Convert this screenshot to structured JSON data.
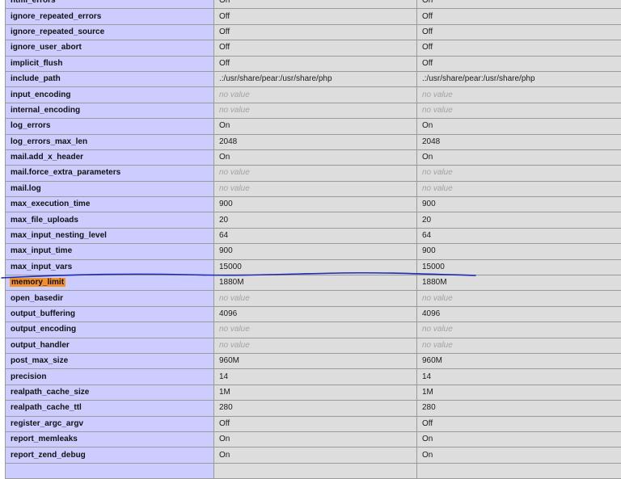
{
  "highlight_color": "#f2902c",
  "annotation_color": "#1e2bb0",
  "table": {
    "no_value_color": "#a3a3a3",
    "rows": [
      {
        "directive": "html_errors",
        "local": "On",
        "master": "On"
      },
      {
        "directive": "ignore_repeated_errors",
        "local": "Off",
        "master": "Off"
      },
      {
        "directive": "ignore_repeated_source",
        "local": "Off",
        "master": "Off"
      },
      {
        "directive": "ignore_user_abort",
        "local": "Off",
        "master": "Off"
      },
      {
        "directive": "implicit_flush",
        "local": "Off",
        "master": "Off"
      },
      {
        "directive": "include_path",
        "local": ".:/usr/share/pear:/usr/share/php",
        "master": ".:/usr/share/pear:/usr/share/php"
      },
      {
        "directive": "input_encoding",
        "local": "no value",
        "master": "no value"
      },
      {
        "directive": "internal_encoding",
        "local": "no value",
        "master": "no value"
      },
      {
        "directive": "log_errors",
        "local": "On",
        "master": "On"
      },
      {
        "directive": "log_errors_max_len",
        "local": "2048",
        "master": "2048"
      },
      {
        "directive": "mail.add_x_header",
        "local": "On",
        "master": "On"
      },
      {
        "directive": "mail.force_extra_parameters",
        "local": "no value",
        "master": "no value"
      },
      {
        "directive": "mail.log",
        "local": "no value",
        "master": "no value"
      },
      {
        "directive": "max_execution_time",
        "local": "900",
        "master": "900"
      },
      {
        "directive": "max_file_uploads",
        "local": "20",
        "master": "20"
      },
      {
        "directive": "max_input_nesting_level",
        "local": "64",
        "master": "64"
      },
      {
        "directive": "max_input_time",
        "local": "900",
        "master": "900"
      },
      {
        "directive": "max_input_vars",
        "local": "15000",
        "master": "15000"
      },
      {
        "directive": "memory_limit",
        "local": "1880M",
        "master": "1880M",
        "highlighted": true
      },
      {
        "directive": "open_basedir",
        "local": "no value",
        "master": "no value"
      },
      {
        "directive": "output_buffering",
        "local": "4096",
        "master": "4096"
      },
      {
        "directive": "output_encoding",
        "local": "no value",
        "master": "no value"
      },
      {
        "directive": "output_handler",
        "local": "no value",
        "master": "no value"
      },
      {
        "directive": "post_max_size",
        "local": "960M",
        "master": "960M"
      },
      {
        "directive": "precision",
        "local": "14",
        "master": "14"
      },
      {
        "directive": "realpath_cache_size",
        "local": "1M",
        "master": "1M"
      },
      {
        "directive": "realpath_cache_ttl",
        "local": "280",
        "master": "280"
      },
      {
        "directive": "register_argc_argv",
        "local": "Off",
        "master": "Off"
      },
      {
        "directive": "report_memleaks",
        "local": "On",
        "master": "On"
      },
      {
        "directive": "report_zend_debug",
        "local": "On",
        "master": "On"
      },
      {
        "directive": "",
        "local": "",
        "master": ""
      }
    ]
  }
}
